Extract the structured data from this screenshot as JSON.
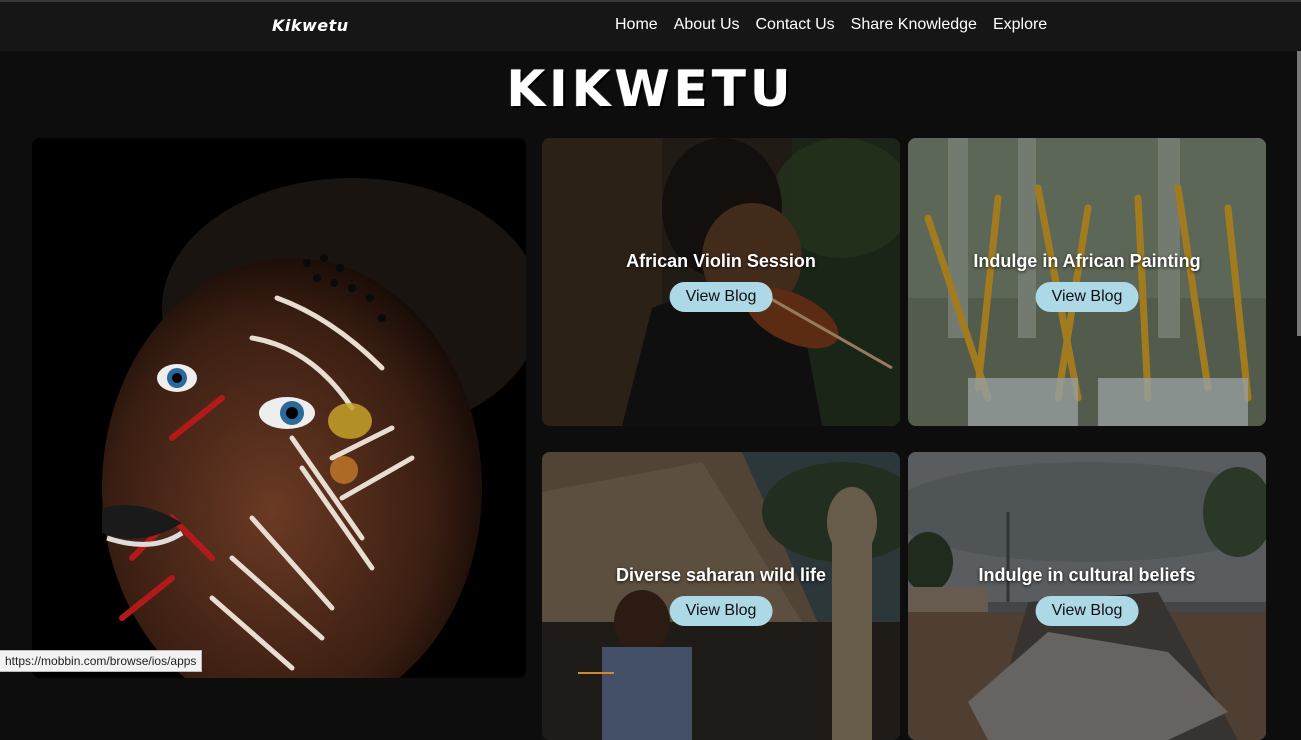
{
  "nav": {
    "logo": "Kikwetu",
    "links": [
      "Home",
      "About Us",
      "Contact Us",
      "Share Knowledge",
      "Explore"
    ]
  },
  "hero": {
    "title": "KIKWETU"
  },
  "cards": [
    {
      "title": "African Violin Session",
      "button": "View Blog"
    },
    {
      "title": "Indulge in African Painting",
      "button": "View Blog"
    },
    {
      "title": "Diverse saharan wild life",
      "button": "View Blog"
    },
    {
      "title": "Indulge in cultural beliefs",
      "button": "View Blog"
    }
  ],
  "status": {
    "url": "https://mobbin.com/browse/ios/apps"
  },
  "colors": {
    "background": "#0d0d0d",
    "nav": "#161616",
    "button": "#add8e6"
  }
}
